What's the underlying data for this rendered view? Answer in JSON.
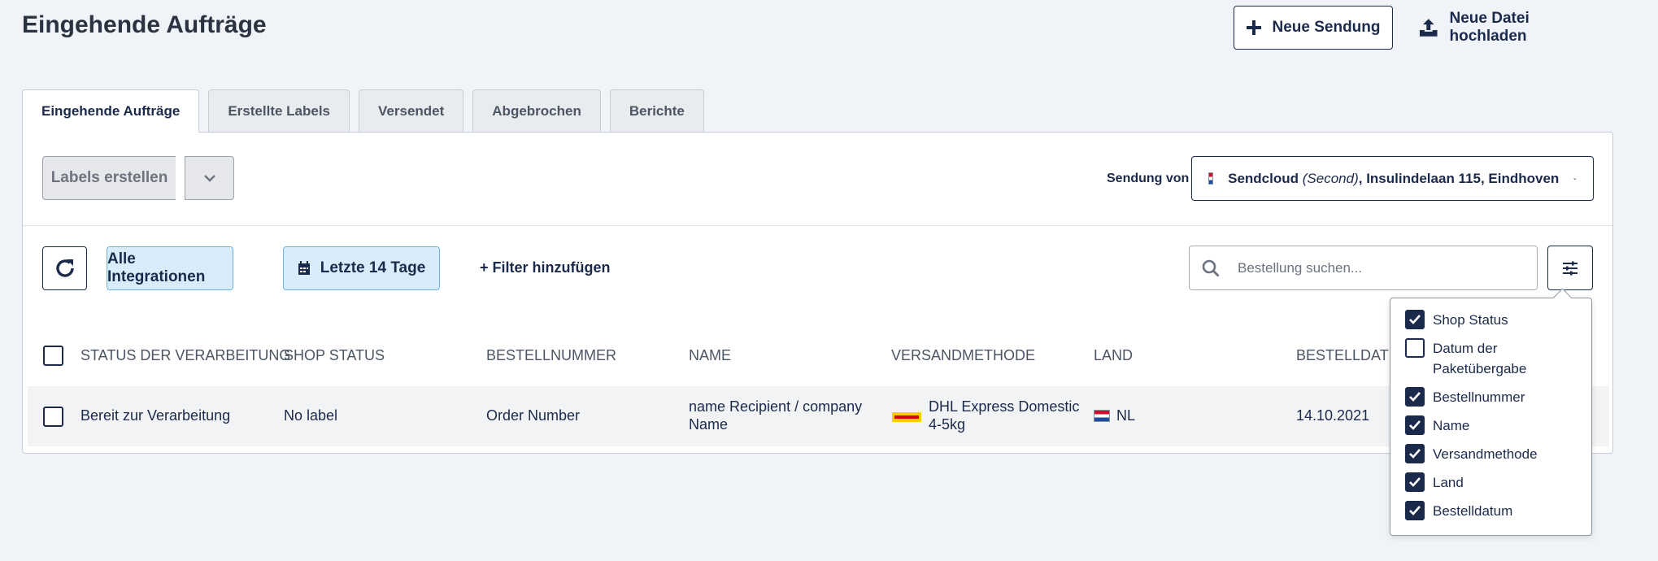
{
  "header": {
    "title": "Eingehende Aufträge",
    "new_shipment_label": "Neue Sendung",
    "upload_label": "Neue Datei hochladen"
  },
  "tabs": [
    {
      "label": "Eingehende Aufträge",
      "active": true
    },
    {
      "label": "Erstellte Labels",
      "active": false
    },
    {
      "label": "Versendet",
      "active": false
    },
    {
      "label": "Abgebrochen",
      "active": false
    },
    {
      "label": "Berichte",
      "active": false
    }
  ],
  "toolbar": {
    "create_labels_label": "Labels erstellen",
    "sender_label": "Sendung von",
    "sender": {
      "name": "Sendcloud",
      "brand": "(Second)",
      "address": ", Insulindelaan 115, Eindhoven"
    }
  },
  "filters": {
    "integrations_label": "Alle Integrationen",
    "period_label": "Letzte 14 Tage",
    "add_filter_label": "+ Filter hinzufügen",
    "search_placeholder": "Bestellung suchen..."
  },
  "table": {
    "columns": [
      "STATUS DER VERARBEITUNG",
      "SHOP STATUS",
      "BESTELLNUMMER",
      "NAME",
      "VERSANDMETHODE",
      "LAND",
      "BESTELLDATUM"
    ],
    "rows": [
      {
        "status": "Bereit zur Verarbeitung",
        "shop_status": "No label",
        "order_number": "Order Number",
        "name_line1": "name Recipient / company",
        "name_line2": "Name",
        "shipping_line1": "DHL Express Domestic",
        "shipping_line2": "4-5kg",
        "country": "NL",
        "order_date": "14.10.2021"
      }
    ]
  },
  "column_menu": {
    "options": [
      {
        "label": "Shop Status",
        "checked": true
      },
      {
        "label": "Datum der Paketübergabe",
        "checked": false
      },
      {
        "label": "Bestellnummer",
        "checked": true
      },
      {
        "label": "Name",
        "checked": true
      },
      {
        "label": "Versandmethode",
        "checked": true
      },
      {
        "label": "Land",
        "checked": true
      },
      {
        "label": "Bestelldatum",
        "checked": true
      }
    ]
  },
  "colors": {
    "primary": "#1b2a4a",
    "chip_bg": "#d9ecfb",
    "chip_border": "#6cb3e8",
    "row_bg": "#f2f3f5",
    "page_bg": "#f0f4f8"
  }
}
